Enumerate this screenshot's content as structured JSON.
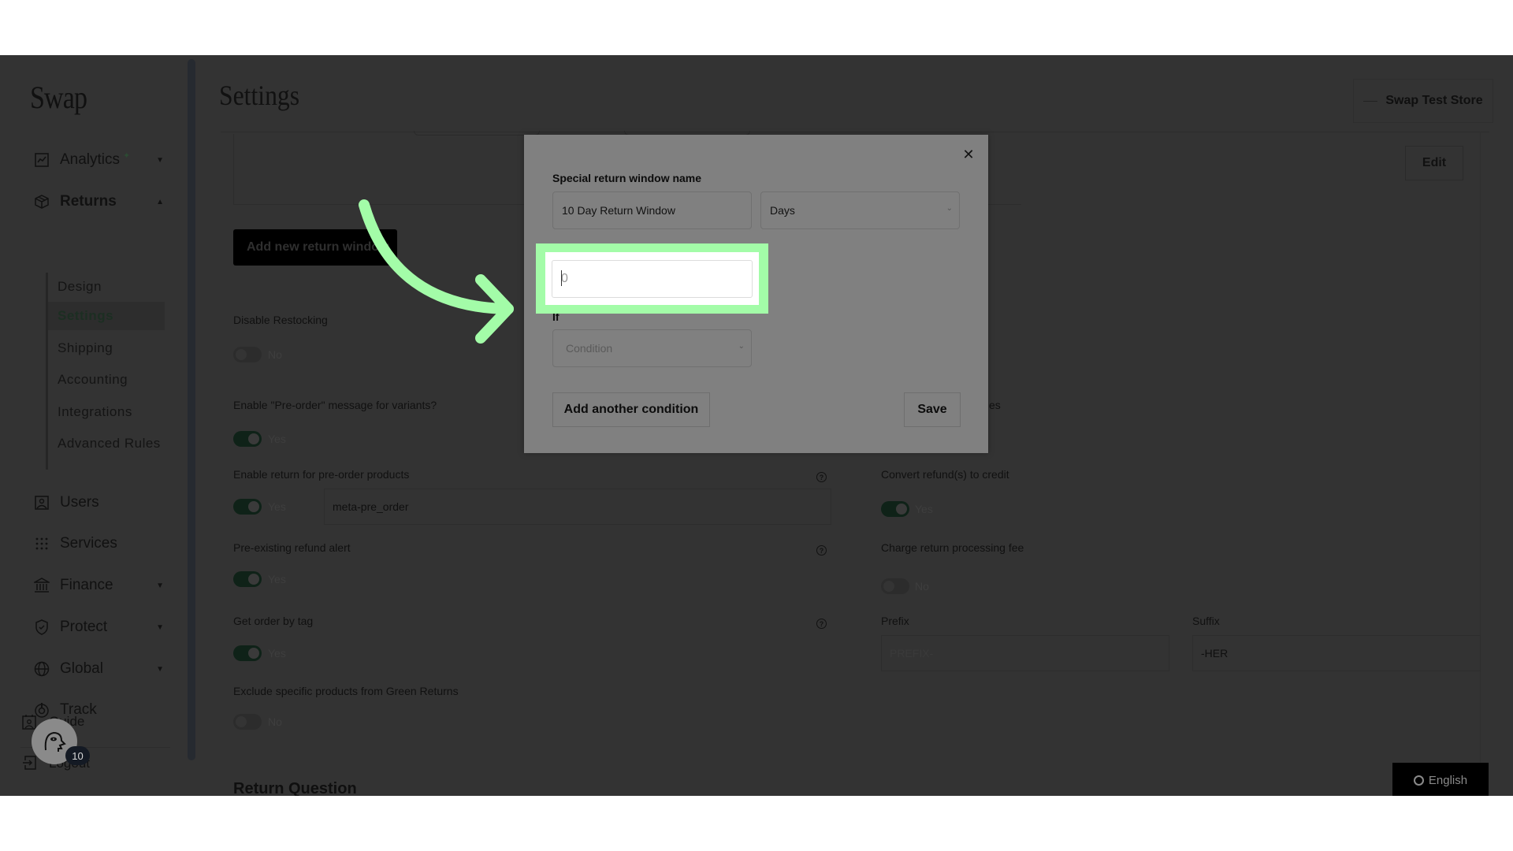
{
  "app": {
    "logo": "Swap",
    "page_title": "Settings",
    "store_name": "Swap Test Store"
  },
  "sidebar": {
    "items": [
      {
        "label": "Analytics",
        "icon": "chart-line-icon",
        "caret": "down",
        "badge_icon": "sparkle-icon"
      },
      {
        "label": "Returns",
        "icon": "box-icon",
        "caret": "up"
      },
      {
        "label": "Users",
        "icon": "user-square-icon"
      },
      {
        "label": "Services",
        "icon": "grid-dots-icon"
      },
      {
        "label": "Finance",
        "icon": "bank-icon",
        "caret": "down"
      },
      {
        "label": "Protect",
        "icon": "shield-check-icon",
        "caret": "down"
      },
      {
        "label": "Global",
        "icon": "globe-icon",
        "caret": "down"
      },
      {
        "label": "Track",
        "icon": "track-icon"
      }
    ],
    "returns_subitems": [
      {
        "label": "Design"
      },
      {
        "label": "Settings",
        "active": true
      },
      {
        "label": "Shipping"
      },
      {
        "label": "Accounting"
      },
      {
        "label": "Integrations"
      },
      {
        "label": "Advanced Rules"
      }
    ],
    "footer": [
      {
        "label": "Guide",
        "icon": "calendar-user-icon"
      },
      {
        "label": "Logout",
        "icon": "logout-icon"
      }
    ],
    "avatar_badge": "10"
  },
  "header": {
    "edit_label": "Edit"
  },
  "main": {
    "add_window_label": "Add new return window",
    "left_settings": [
      {
        "label": "Disable Restocking",
        "toggle": false,
        "value": "No"
      },
      {
        "label": "Enable \"Pre-order\" message for variants?",
        "toggle": true,
        "value": "Yes"
      },
      {
        "label": "Enable return for pre-order products",
        "toggle": true,
        "value": "Yes",
        "field_value": "meta-pre_order",
        "help": true
      },
      {
        "label": "Pre-existing refund alert",
        "toggle": true,
        "value": "Yes",
        "help": true
      },
      {
        "label": "Get order by tag",
        "toggle": true,
        "value": "Yes",
        "help": true
      },
      {
        "label": "Exclude specific products from Green Returns",
        "toggle": false,
        "value": "No"
      }
    ],
    "right_settings": {
      "partial_label": "es",
      "convert_refund": {
        "label": "Convert refund(s) to credit",
        "toggle": true,
        "value": "Yes"
      },
      "processing_fee": {
        "label": "Charge return processing fee",
        "toggle": false,
        "value": "No"
      },
      "prefix": {
        "label": "Prefix",
        "placeholder": "PREFIX-"
      },
      "suffix": {
        "label": "Suffix",
        "value": "-HER"
      }
    },
    "section_title": "Return Question",
    "language_label": "English"
  },
  "modal": {
    "name_label": "Special return window name",
    "name_value": "10 Day Return Window",
    "unit_value": "Days",
    "days_placeholder": "0",
    "days_value": "",
    "if_label": "If",
    "condition_placeholder": "Condition",
    "add_condition_label": "Add another condition",
    "save_label": "Save",
    "close_icon": "close-icon"
  },
  "annotation": {
    "highlight_color": "#a3fca8",
    "arrow_color": "#a3fca8"
  }
}
